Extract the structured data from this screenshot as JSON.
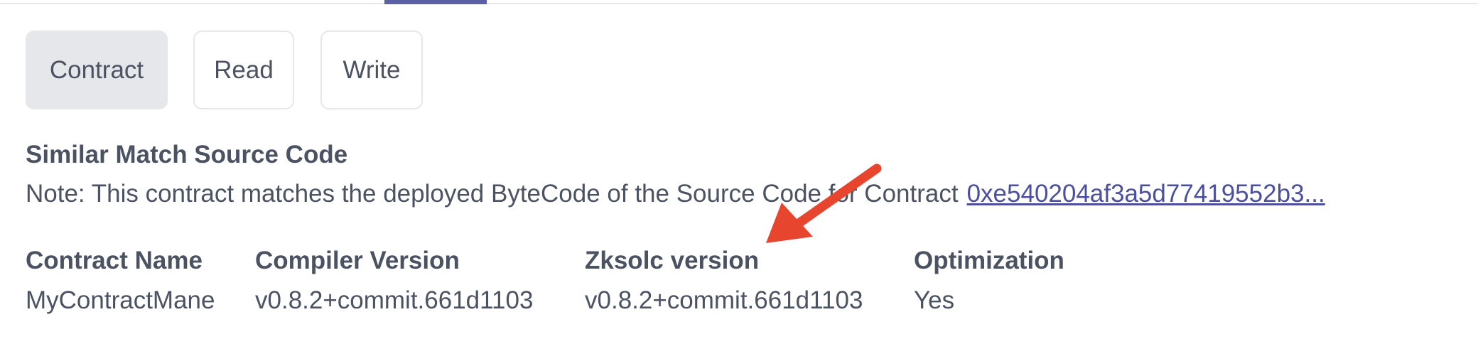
{
  "tabs": {
    "active_indicator_color": "#5b5fa8"
  },
  "toolbar": {
    "contract_label": "Contract",
    "read_label": "Read",
    "write_label": "Write",
    "active": "Contract"
  },
  "source": {
    "title": "Similar Match Source Code",
    "note_text": "Note: This contract matches the deployed ByteCode of the Source Code for Contract",
    "contract_link": "0xe540204af3a5d77419552b3..."
  },
  "details": {
    "columns": [
      {
        "header": "Contract Name",
        "value": "MyContractMane"
      },
      {
        "header": "Compiler Version",
        "value": "v0.8.2+commit.661d1103"
      },
      {
        "header": "Zksolc version",
        "value": "v0.8.2+commit.661d1103"
      },
      {
        "header": "Optimization",
        "value": "Yes"
      }
    ]
  },
  "annotation": {
    "icon": "red-arrow-icon",
    "color": "#e8452f"
  }
}
